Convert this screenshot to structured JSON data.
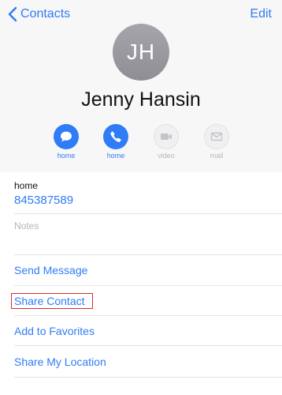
{
  "nav": {
    "back_label": "Contacts",
    "edit_label": "Edit"
  },
  "contact": {
    "initials": "JH",
    "name": "Jenny Hansin"
  },
  "actions": [
    {
      "label": "home",
      "icon": "message-icon",
      "enabled": true
    },
    {
      "label": "home",
      "icon": "phone-icon",
      "enabled": true
    },
    {
      "label": "video",
      "icon": "video-icon",
      "enabled": false
    },
    {
      "label": "mail",
      "icon": "mail-icon",
      "enabled": false
    }
  ],
  "phone": {
    "label": "home",
    "number": "845387589"
  },
  "notes": {
    "placeholder": "Notes"
  },
  "menu": [
    "Send Message",
    "Share Contact",
    "Add to Favorites",
    "Share My Location"
  ],
  "colors": {
    "accent": "#2f7cf6",
    "avatar": "#98989e",
    "highlight": "#e02b2b"
  }
}
